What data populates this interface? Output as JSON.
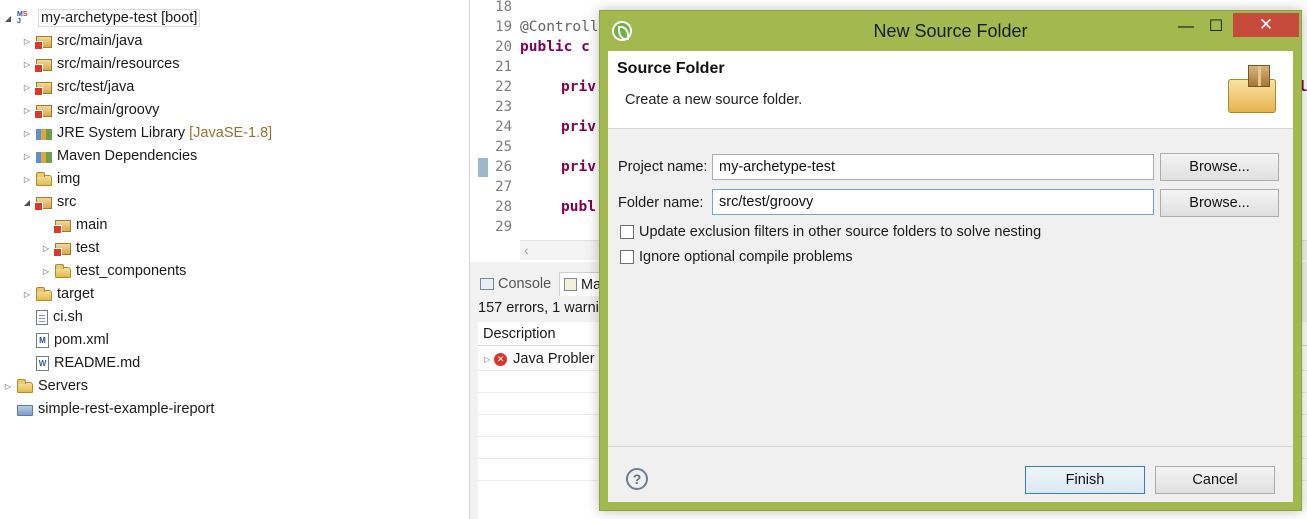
{
  "explorer": {
    "project": {
      "name": "my-archetype-test",
      "decoration": "[boot]"
    },
    "items": [
      {
        "label": "src/main/java",
        "icon": "source-folder-icon"
      },
      {
        "label": "src/main/resources",
        "icon": "source-folder-icon"
      },
      {
        "label": "src/test/java",
        "icon": "source-folder-icon"
      },
      {
        "label": "src/main/groovy",
        "icon": "source-folder-icon"
      },
      {
        "label": "JRE System Library",
        "decoration": "[JavaSE-1.8]",
        "icon": "library-icon"
      },
      {
        "label": "Maven Dependencies",
        "icon": "library-icon"
      },
      {
        "label": "img",
        "icon": "folder-icon"
      },
      {
        "label": "src",
        "icon": "folder-icon"
      },
      {
        "label": "main",
        "icon": "package-folder-icon"
      },
      {
        "label": "test",
        "icon": "package-folder-icon"
      },
      {
        "label": "test_components",
        "icon": "folder-icon"
      },
      {
        "label": "target",
        "icon": "folder-icon"
      },
      {
        "label": "ci.sh",
        "icon": "file-icon"
      },
      {
        "label": "pom.xml",
        "icon": "maven-file-icon"
      },
      {
        "label": "README.md",
        "icon": "markdown-file-icon"
      },
      {
        "label": "Servers",
        "icon": "folder-icon"
      },
      {
        "label": "simple-rest-example-ireport",
        "icon": "project-icon"
      }
    ]
  },
  "editor": {
    "line_numbers": [
      "18",
      "19",
      "20",
      "21",
      "22",
      "23",
      "24",
      "25",
      "26",
      "27",
      "28",
      "29"
    ],
    "lines": {
      "l19": "@Controll",
      "l20_kw": "public",
      "l20_rest": " c",
      "l22": "priv",
      "l24": "priv",
      "l26": "priv",
      "l28": "publ"
    },
    "right_peek": "el"
  },
  "bottom_panel": {
    "tabs": [
      {
        "label": "Console"
      },
      {
        "label": "Ma"
      }
    ],
    "summary": "157 errors, 1 warni",
    "column_header": "Description",
    "rows": [
      {
        "label": "Java Probler"
      }
    ]
  },
  "dialog": {
    "title": "New Source Folder",
    "window_controls": {
      "minimize": "—",
      "maximize": "☐",
      "close": "✕"
    },
    "banner": {
      "title": "Source Folder",
      "description": "Create a new source folder."
    },
    "form": {
      "project_label": "Project name:",
      "project_value": "my-archetype-test",
      "folder_label": "Folder name:",
      "folder_value": "src/test/groovy",
      "browse_label": "Browse...",
      "checkbox_update": "Update exclusion filters in other source folders to solve nesting",
      "checkbox_ignore": "Ignore optional compile problems"
    },
    "help_glyph": "?",
    "finish_label": "Finish",
    "cancel_label": "Cancel",
    "accent_color": "#a3b84f",
    "close_color": "#c74b3c"
  }
}
